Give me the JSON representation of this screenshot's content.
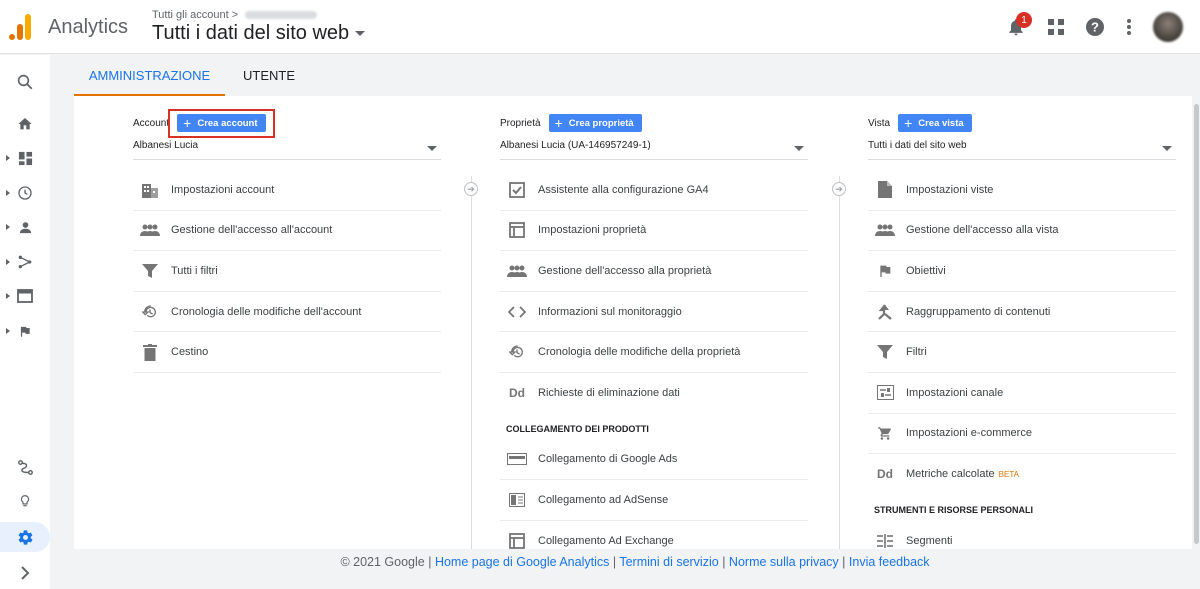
{
  "header": {
    "app_name": "Analytics",
    "breadcrumb_top": "Tutti gli account",
    "breadcrumb_sep": ">",
    "property_view": "Tutti i dati del sito web",
    "notification_count": "1"
  },
  "tabs": [
    {
      "label": "AMMINISTRAZIONE"
    },
    {
      "label": "UTENTE"
    }
  ],
  "account": {
    "label": "Account",
    "create_label": "Crea account",
    "selected": "Albanesi Lucia",
    "items": [
      {
        "icon": "building-icon",
        "label": "Impostazioni account"
      },
      {
        "icon": "people-icon",
        "label": "Gestione dell'accesso all'account"
      },
      {
        "icon": "filter-icon",
        "label": "Tutti i filtri"
      },
      {
        "icon": "history-icon",
        "label": "Cronologia delle modifiche dell'account"
      },
      {
        "icon": "trash-icon",
        "label": "Cestino"
      }
    ]
  },
  "property": {
    "label": "Proprietà",
    "create_label": "Crea proprietà",
    "selected": "Albanesi Lucia (UA-146957249-1)",
    "items": [
      {
        "icon": "checkbox-icon",
        "label": "Assistente alla configurazione GA4"
      },
      {
        "icon": "window-icon",
        "label": "Impostazioni proprietà"
      },
      {
        "icon": "people-icon",
        "label": "Gestione dell'accesso alla proprietà"
      },
      {
        "icon": "code-icon",
        "label": "Informazioni sul monitoraggio"
      },
      {
        "icon": "history-icon",
        "label": "Cronologia delle modifiche della proprietà"
      },
      {
        "icon": "dd-icon",
        "icon_text": "Dd",
        "label": "Richieste di eliminazione dati"
      }
    ],
    "section_title": "COLLEGAMENTO DEI PRODOTTI",
    "links": [
      {
        "icon": "google-ads-icon",
        "label": "Collegamento di Google Ads"
      },
      {
        "icon": "adsense-icon",
        "label": "Collegamento ad AdSense"
      },
      {
        "icon": "ad-exchange-icon",
        "label": "Collegamento Ad Exchange"
      }
    ]
  },
  "view": {
    "label": "Vista",
    "create_label": "Crea vista",
    "selected": "Tutti i dati del sito web",
    "items": [
      {
        "icon": "document-icon",
        "label": "Impostazioni viste"
      },
      {
        "icon": "people-icon",
        "label": "Gestione dell'accesso alla vista"
      },
      {
        "icon": "flag-icon",
        "label": "Obiettivi"
      },
      {
        "icon": "grouping-icon",
        "label": "Raggruppamento di contenuti"
      },
      {
        "icon": "filter-icon",
        "label": "Filtri"
      },
      {
        "icon": "channel-icon",
        "label": "Impostazioni canale"
      },
      {
        "icon": "cart-icon",
        "label": "Impostazioni e-commerce"
      },
      {
        "icon": "dd-icon",
        "icon_text": "Dd",
        "label": "Metriche calcolate",
        "badge": "BETA"
      }
    ],
    "section_title": "STRUMENTI E RISORSE PERSONALI",
    "tools": [
      {
        "icon": "segments-icon",
        "label": "Segmenti"
      }
    ]
  },
  "footer": {
    "copyright": "© 2021 Google |",
    "links": [
      "Home page di Google Analytics",
      "Termini di servizio",
      "Norme sulla privacy",
      "Invia feedback"
    ],
    "sep": "|"
  },
  "colors": {
    "accent_blue": "#1a73e8",
    "button_blue": "#4285f4",
    "tab_underline": "#e37400",
    "highlight_red": "#d93025"
  }
}
